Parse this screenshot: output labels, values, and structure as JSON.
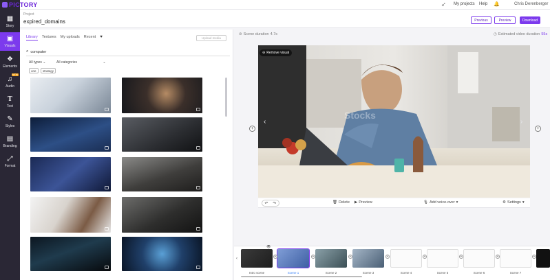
{
  "brand": {
    "name": "PICTORY"
  },
  "topbar": {
    "my_projects": "My projects",
    "help": "Help",
    "user": "Chris Derenberger"
  },
  "project": {
    "label": "Project",
    "name": "expired_domains"
  },
  "header_buttons": {
    "previous": "Previous",
    "preview": "Preview",
    "download": "Download"
  },
  "nav": [
    {
      "label": "Story",
      "icon": "grid-icon"
    },
    {
      "label": "Visuals",
      "icon": "image-icon"
    },
    {
      "label": "Elements",
      "icon": "shapes-icon"
    },
    {
      "label": "Audio",
      "icon": "music-icon",
      "badge": "NEW"
    },
    {
      "label": "Text",
      "icon": "text-icon"
    },
    {
      "label": "Styles",
      "icon": "brush-icon"
    },
    {
      "label": "Branding",
      "icon": "briefcase-icon"
    },
    {
      "label": "Format",
      "icon": "resize-icon"
    }
  ],
  "library": {
    "tabs": [
      "Library",
      "Textures",
      "My uploads",
      "Recent"
    ],
    "upload_button": "Upload media",
    "search_value": "computer",
    "filter_types": "All types",
    "filter_categories": "All categories",
    "chips": [
      "one",
      "strategy"
    ]
  },
  "stage": {
    "scene_duration_label": "Scene duration",
    "scene_duration_value": "4.7s",
    "est_duration_label": "Estimated video duration",
    "est_duration_value": "55s",
    "remove_visual": "Remove visual",
    "watermark": "Stocks"
  },
  "controls": {
    "delete": "Delete",
    "preview": "Preview",
    "voice_over": "Add voice-over",
    "settings": "Settings"
  },
  "timeline": {
    "scenes": [
      "Intro scene",
      "Scene 1",
      "Scene 2",
      "Scene 3",
      "Scene 4",
      "Scene 5",
      "Scene 6",
      "Scene 7"
    ]
  },
  "colors": {
    "accent": "#7c3aed",
    "nav_bg": "#2a2735",
    "selected_label": "#3b82f6"
  }
}
